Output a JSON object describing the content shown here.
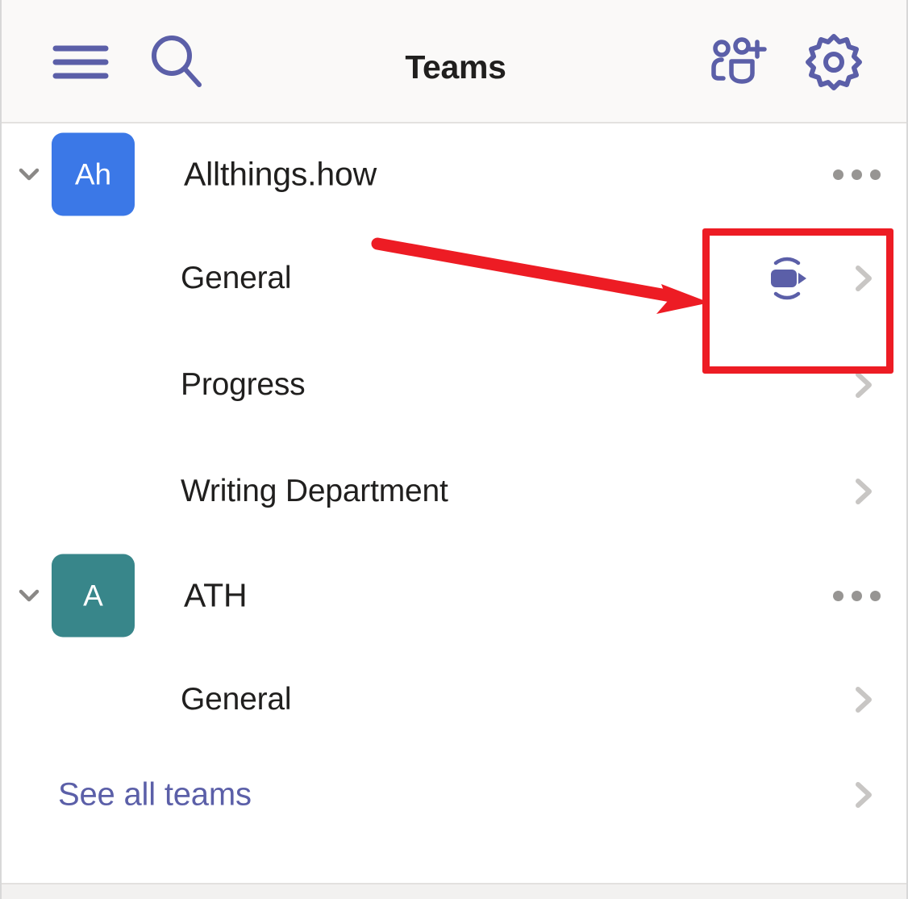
{
  "app": {
    "title": "Teams",
    "accent_purple": "#5b5fa8",
    "header_bg": "#faf9f8",
    "text_color": "#201f1e",
    "chevron_color": "#c8c6c4",
    "more_dot_color": "#979593",
    "annotation_color": "#ed1c24"
  },
  "header": {
    "title": "Teams",
    "menu_icon": "hamburger-menu-icon",
    "search_icon": "search-icon",
    "add_team_icon": "join-or-create-team-icon",
    "settings_icon": "gear-icon"
  },
  "teams": [
    {
      "name": "Allthings.how",
      "avatar_initials": "Ah",
      "avatar_color": "#3b78e7",
      "expanded": true,
      "more_label": "•••",
      "channels": [
        {
          "name": "General",
          "has_meet_now": true,
          "meet_icon": "meet-now-video-icon"
        },
        {
          "name": "Progress",
          "has_meet_now": false,
          "meet_icon": ""
        },
        {
          "name": "Writing Department",
          "has_meet_now": false,
          "meet_icon": ""
        }
      ]
    },
    {
      "name": "ATH",
      "avatar_initials": "A",
      "avatar_color": "#38868a",
      "expanded": true,
      "more_label": "•••",
      "channels": [
        {
          "name": "General",
          "has_meet_now": false,
          "meet_icon": ""
        }
      ]
    }
  ],
  "footer": {
    "see_all_teams_label": "See all teams"
  },
  "annotations": {
    "highlight_box": {
      "target": "meet-now-video-icon",
      "color": "#ed1c24"
    },
    "arrow": {
      "color": "#ed1c24",
      "points_to": "meet-now-video-icon"
    }
  }
}
